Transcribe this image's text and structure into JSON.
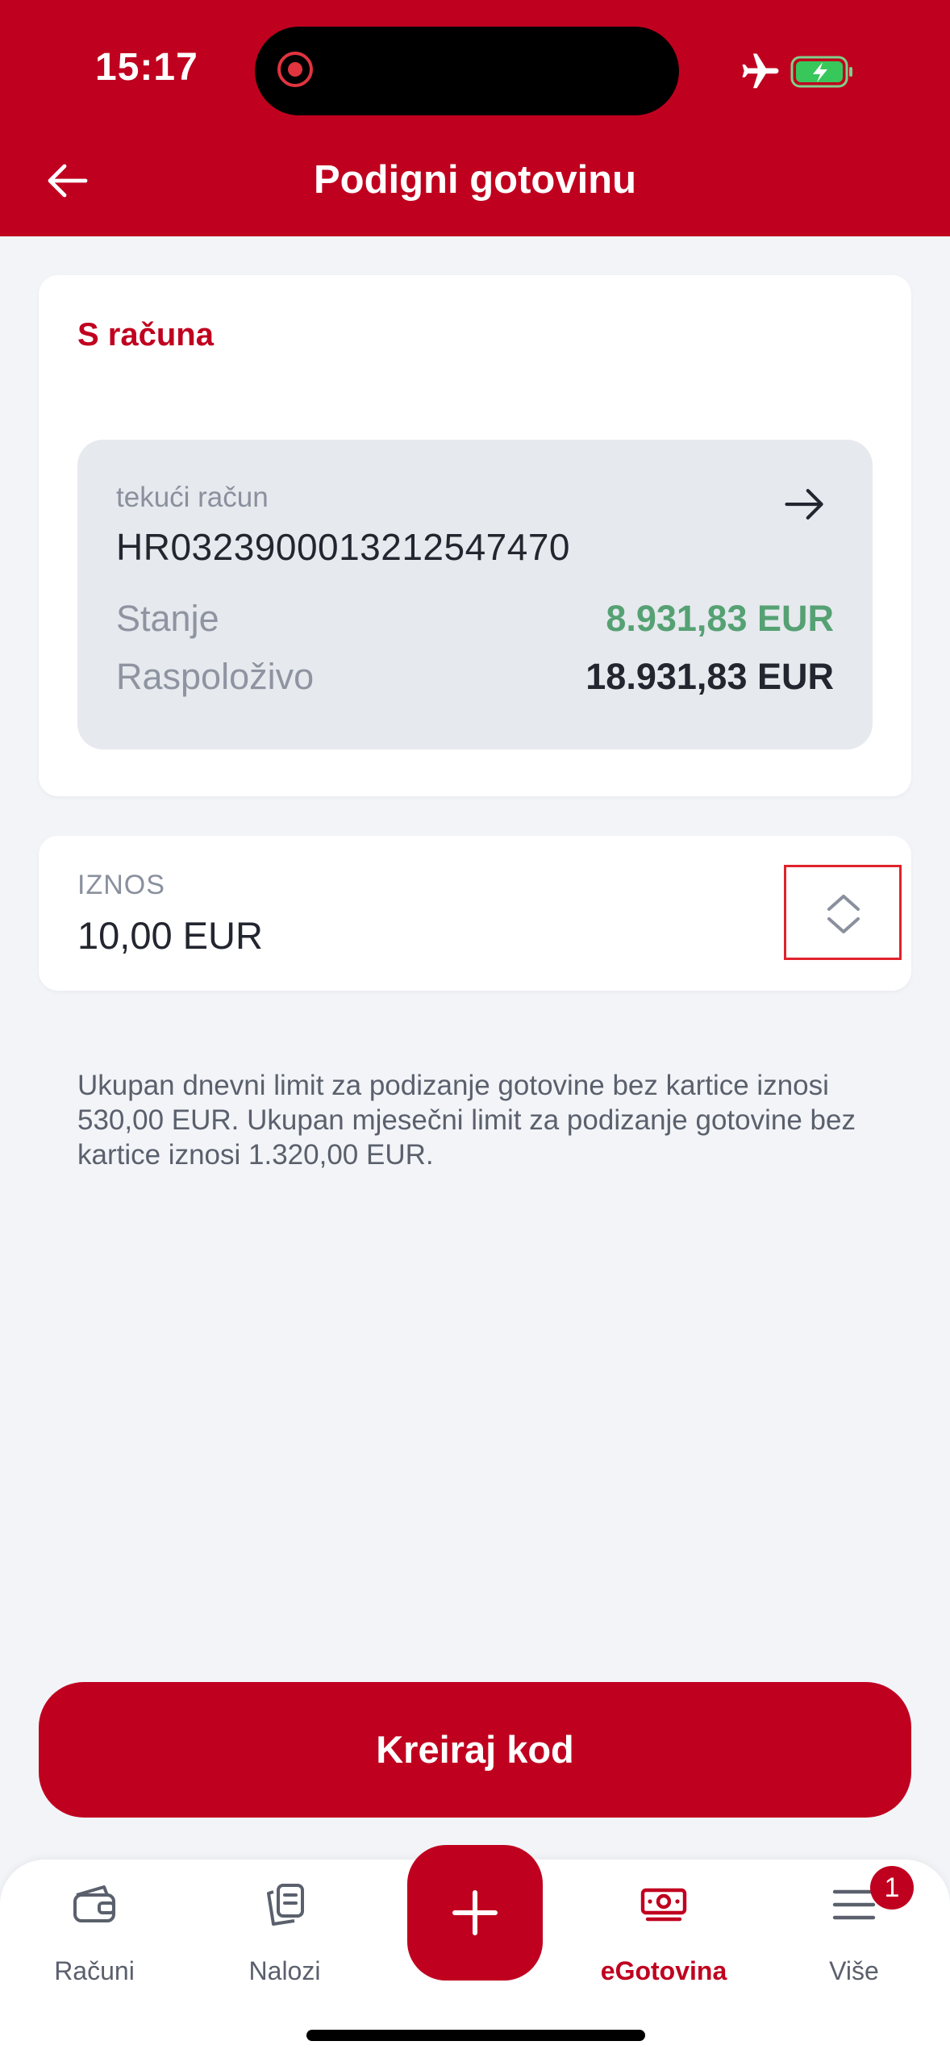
{
  "status_bar": {
    "time": "15:17"
  },
  "header": {
    "title": "Podigni gotovinu"
  },
  "account": {
    "section_title": "S računa",
    "type": "tekući račun",
    "iban": "HR0323900013212547470",
    "balance_label": "Stanje",
    "balance_value": "8.931,83 EUR",
    "available_label": "Raspoloživo",
    "available_value": "18.931,83 EUR"
  },
  "amount": {
    "label": "IZNOS",
    "value": "10,00 EUR"
  },
  "info_text": "Ukupan dnevni limit za podizanje gotovine bez kartice iznosi 530,00 EUR. Ukupan mjesečni limit za podizanje gotovine bez kartice iznosi 1.320,00 EUR.",
  "cta": {
    "label": "Kreiraj kod"
  },
  "tabbar": {
    "items": [
      {
        "label": "Računi",
        "icon": "wallet-icon"
      },
      {
        "label": "Nalozi",
        "icon": "documents-icon"
      },
      {
        "label": "eGotovina",
        "icon": "cash-icon",
        "active": true
      },
      {
        "label": "Više",
        "icon": "menu-icon",
        "badge": "1"
      }
    ],
    "fab_icon": "plus-icon"
  },
  "colors": {
    "brand": "#c0001f",
    "positive": "#55a173",
    "background": "#f2f4f8"
  }
}
